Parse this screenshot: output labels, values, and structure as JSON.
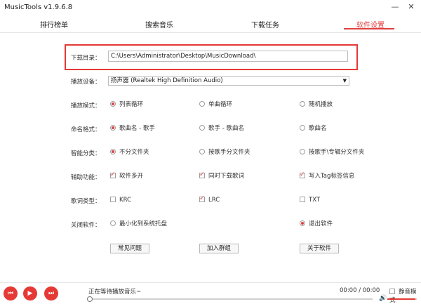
{
  "app": {
    "title": "MusicTools v1.9.6.8"
  },
  "window_controls": {
    "minimize_icon": "minimize-icon",
    "close_icon": "close-icon"
  },
  "tabs": [
    {
      "label": "排行榜单",
      "active": false
    },
    {
      "label": "搜索音乐",
      "active": false
    },
    {
      "label": "下载任务",
      "active": false
    },
    {
      "label": "软件设置",
      "active": true
    }
  ],
  "settings": {
    "download_dir": {
      "label": "下载目录：",
      "value": "C:\\Users\\Administrator\\Desktop\\MusicDownload\\"
    },
    "playback_device": {
      "label": "播放设备：",
      "value": "扬声器 (Realtek High Definition Audio)"
    },
    "play_mode": {
      "label": "播放模式：",
      "options": [
        "列表循环",
        "单曲循环",
        "随机播放"
      ],
      "selected": 0
    },
    "naming": {
      "label": "命名格式：",
      "options": [
        "歌曲名 - 歌手",
        "歌手 - 歌曲名",
        "歌曲名"
      ],
      "selected": 0
    },
    "classify": {
      "label": "智能分类：",
      "options": [
        "不分文件夹",
        "按歌手分文件夹",
        "按歌手\\专辑分文件夹"
      ],
      "selected": 0
    },
    "assist": {
      "label": "辅助功能：",
      "options": [
        "软件多开",
        "同时下载歌词",
        "写入Tag标签信息"
      ],
      "checked": [
        true,
        true,
        true
      ]
    },
    "lyrics_type": {
      "label": "歌词类型：",
      "options": [
        "KRC",
        "LRC",
        "TXT"
      ],
      "checked": [
        false,
        true,
        false
      ]
    },
    "close_action": {
      "label": "关闭软件：",
      "options": [
        "最小化到系统托盘",
        "退出软件"
      ],
      "selected": 1
    }
  },
  "buttons": {
    "faq": "常见问题",
    "join_group": "加入群组",
    "about": "关于软件"
  },
  "player": {
    "status": "正在等待播放音乐~",
    "time": "00:00 / 00:00",
    "mute_label": "静音模式",
    "progress": 0,
    "volume": 0.95
  },
  "colors": {
    "accent": "#e53935"
  }
}
